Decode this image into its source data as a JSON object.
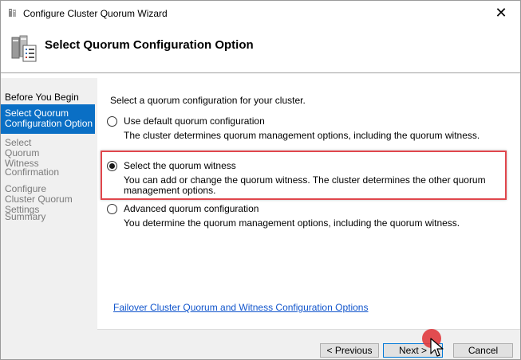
{
  "window": {
    "title": "Configure Cluster Quorum Wizard",
    "close_label": "✕",
    "header_title": "Select Quorum Configuration Option"
  },
  "nav": {
    "items": [
      {
        "label": "Before You Begin",
        "state": "done"
      },
      {
        "label": "Select Quorum Configuration Option",
        "state": "active"
      },
      {
        "label": "Select Quorum Witness",
        "state": "pending"
      },
      {
        "label": "Confirmation",
        "state": "pending"
      },
      {
        "label": "Configure Cluster Quorum Settings",
        "state": "pending"
      },
      {
        "label": "Summary",
        "state": "pending"
      }
    ]
  },
  "content": {
    "intro": "Select a quorum configuration for your cluster.",
    "options": [
      {
        "label": "Use default quorum configuration",
        "description": "The cluster determines quorum management options, including the quorum witness.",
        "checked": false
      },
      {
        "label": "Select the quorum witness",
        "description": "You can add or change the quorum witness. The cluster determines the other quorum management options.",
        "checked": true
      },
      {
        "label": "Advanced quorum configuration",
        "description": "You determine the quorum management options, including the quorum witness.",
        "checked": false
      }
    ],
    "help_link": "Failover Cluster Quorum and Witness Configuration Options"
  },
  "buttons": {
    "previous": "< Previous",
    "next": "Next >",
    "cancel": "Cancel"
  },
  "colors": {
    "nav_active_bg": "#0a6fc5",
    "highlight_border": "#e0464c",
    "link": "#1155cc",
    "cursor_marker": "#e03a3e"
  },
  "icons": {
    "title": "cluster-wizard-icon",
    "header": "cluster-servers-icon"
  }
}
